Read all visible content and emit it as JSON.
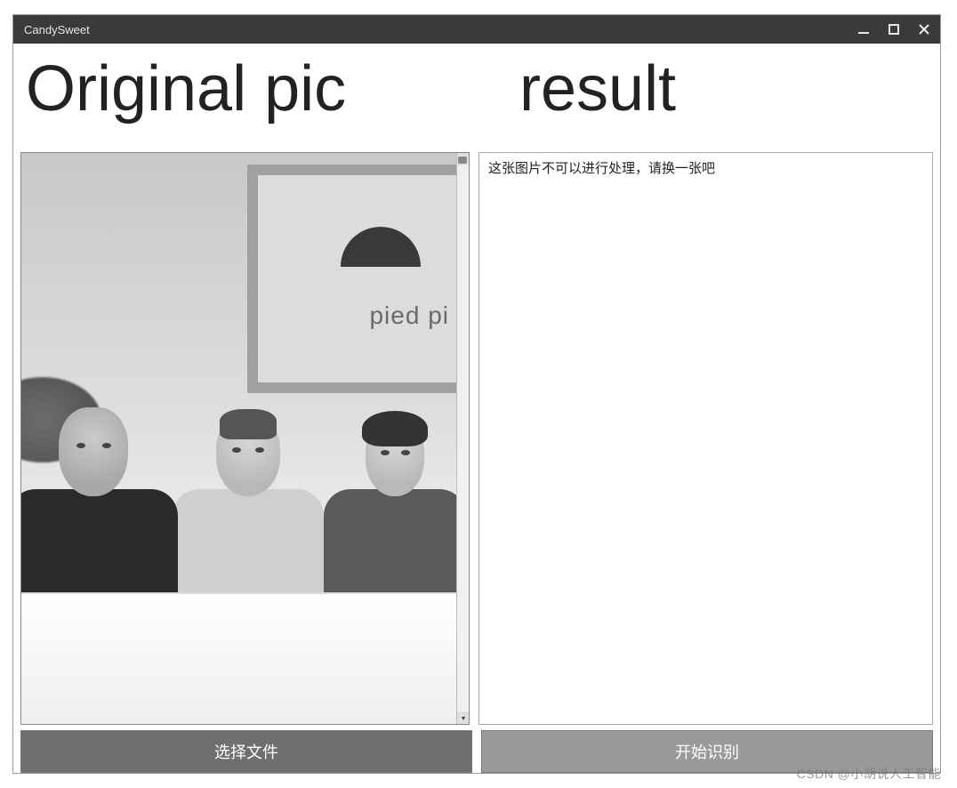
{
  "window": {
    "title": "CandySweet"
  },
  "headings": {
    "left": "Original pic",
    "right": "result"
  },
  "image": {
    "background_logo_text": "pied pi"
  },
  "result": {
    "text": "这张图片不可以进行处理，请换一张吧"
  },
  "buttons": {
    "select_file": "选择文件",
    "start_recognize": "开始识别"
  },
  "watermark": "CSDN @小胡说人工智能"
}
